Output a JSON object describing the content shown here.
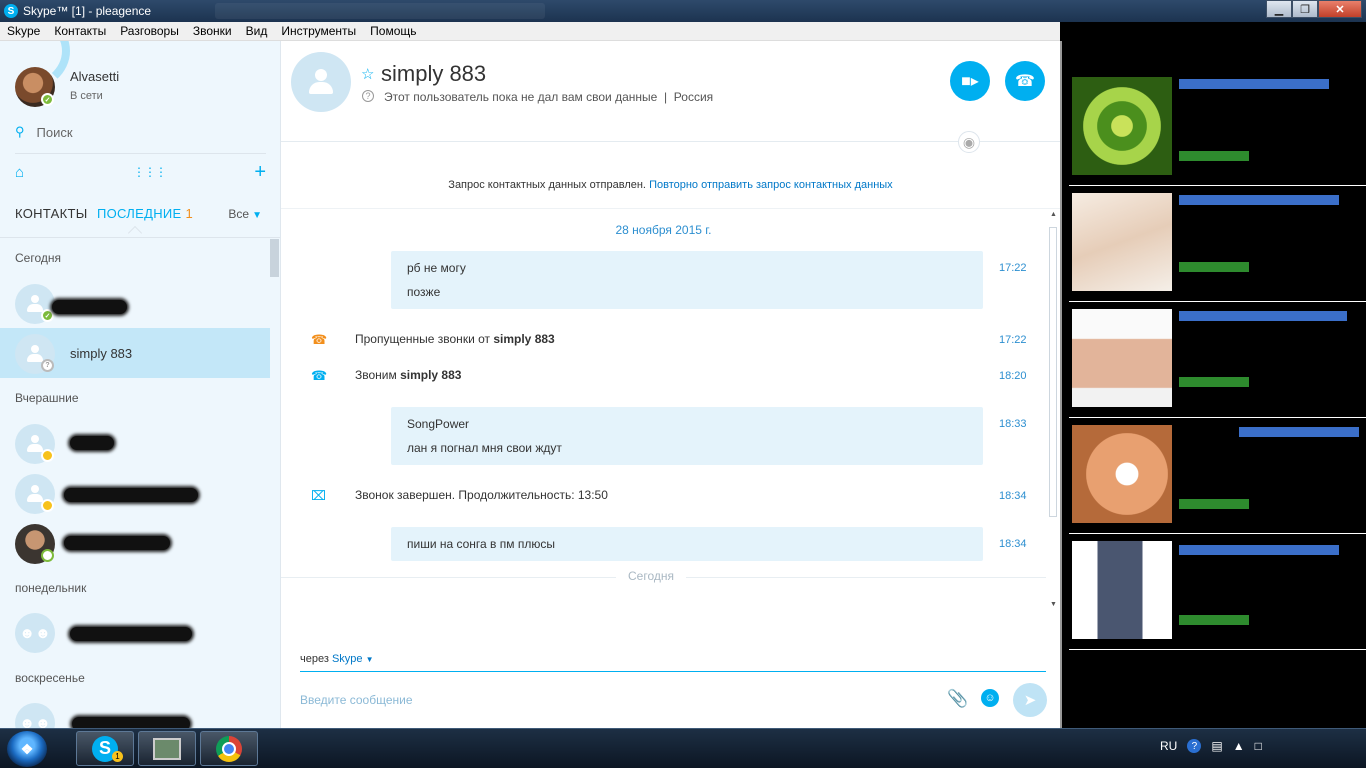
{
  "window": {
    "title": "Skype™ [1] - pleagence",
    "app_icon": "S",
    "buttons": {
      "minimize": "▁",
      "maximize": "❐",
      "close": "✕"
    }
  },
  "menu": [
    "Skype",
    "Контакты",
    "Разговоры",
    "Звонки",
    "Вид",
    "Инструменты",
    "Помощь"
  ],
  "profile": {
    "name": "Alvasetti",
    "status": "В сети"
  },
  "search": {
    "label": "Поиск",
    "icon": "search-icon"
  },
  "tabs": {
    "contacts": "КОНТАКТЫ",
    "recent": "ПОСЛЕДНИЕ",
    "recent_count": "1",
    "filter": "Все"
  },
  "sections": {
    "today": "Сегодня",
    "yesterday": "Вчерашние",
    "monday": "понедельник",
    "sunday": "воскресенье"
  },
  "contacts": {
    "selected_name": "simply 883"
  },
  "chat": {
    "contact_name": "simply 883",
    "info_text": "Этот пользователь пока не дал вам свои данные",
    "separator": "|",
    "country": "Россия",
    "request_text": "Запрос контактных данных отправлен.",
    "request_link": "Повторно отправить запрос контактных данных",
    "date": "28 ноября 2015 г.",
    "today_label": "Сегодня",
    "messages": [
      {
        "lines": [
          "рб не могу",
          "позже"
        ],
        "time": "17:22"
      },
      {
        "lines": [
          "SongPower",
          "лан я погнал мня свои ждут"
        ],
        "time": "18:33"
      },
      {
        "lines": [
          "пиши на сонга в пм плюсы"
        ],
        "time": "18:34"
      }
    ],
    "events": [
      {
        "prefix": "Пропущенные звонки от ",
        "name": "simply 883",
        "time": "17:22",
        "color": "#f28f1c"
      },
      {
        "prefix": "Звоним ",
        "name": "simply 883",
        "time": "18:20",
        "color": "#00aff0"
      },
      {
        "prefix": "Звонок завершен. Продолжительность: 13:50",
        "name": "",
        "time": "18:34",
        "color": "#00aff0"
      }
    ],
    "via_prefix": "через",
    "via_service": "Skype",
    "input_placeholder": "Введите сообщение"
  },
  "ads": [
    {
      "title": "...",
      "image": "tomato-slice"
    },
    {
      "title": "...",
      "image": "feet-sandals"
    },
    {
      "title": "...",
      "image": "abs-belly"
    },
    {
      "title": "...",
      "image": "cream-hand"
    },
    {
      "title": "...",
      "image": "woman-dress"
    }
  ],
  "taskbar": {
    "skype_badge": "1",
    "lang": "RU"
  },
  "colors": {
    "accent": "#00aff0",
    "online": "#7dbb3b",
    "away": "#f8c21b",
    "missed": "#f28f1c"
  }
}
